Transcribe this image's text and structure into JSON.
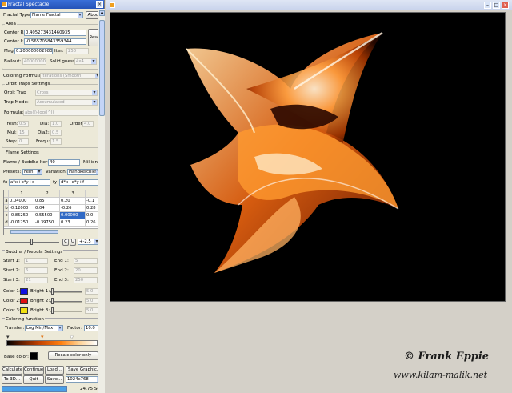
{
  "window": {
    "title": "Fractal Spectacle",
    "close_glyph": "×"
  },
  "top": {
    "fractal_type_label": "Fractal Type:",
    "fractal_type_value": "Flame Fractal",
    "about_label": "About"
  },
  "area": {
    "group_label": "Area",
    "center_r_label": "Center R:",
    "center_r_value": "0.405273431460935",
    "center_i_label": "Center I:",
    "center_i_value": "-0.565705843359344",
    "reset_label": "Reset",
    "mag_label": "Mag",
    "mag_value": "0.2000000029802",
    "iter_label": "Iter:",
    "iter_value": "250",
    "bailout_label": "Bailout:",
    "bailout_value": "400000000",
    "solid_guess_label": "Solid guess:",
    "solid_guess_value": "4x4"
  },
  "coloring_formula": {
    "label": "Coloring Formula:",
    "value": "Iterations (Smooth)"
  },
  "orbit": {
    "group_label": "Orbit Traps Settings",
    "trap_label": "Orbit Trap",
    "trap_value": "Cross",
    "mode_label": "Trap Mode:",
    "mode_value": "Accumulated",
    "formula_label": "Formula:",
    "formula_value": "abs(l)-log(l^l)",
    "thresh_label": "Tresh:",
    "thresh_value": "0.5",
    "dia_label": "Dia:",
    "dia_value": "1.0",
    "order_label": "Order:",
    "order_value": "4.0",
    "mul_label": "Mul:",
    "mul_value": "15",
    "dia2_label": "Dia2:",
    "dia2_value": "0.5",
    "step_label": "Step:",
    "step_value": "0",
    "freq_label": "Frequ:",
    "freq_value": "1.5"
  },
  "flame": {
    "group_label": "Flame Settings",
    "iter_label": "Flame / Buddha Iter:",
    "iter_value": "40",
    "millions_label": "Millions",
    "presets_label": "Presets:",
    "presets_value": "Fern",
    "variation_label": "Variation:",
    "variation_value": "Handkerchief",
    "fx_label": "fx",
    "fx_value": "a*x+b*y+c",
    "fy_label": "fy",
    "fy_value": "d*x+e*y+f",
    "columns": [
      "",
      "1",
      "2",
      "3",
      ""
    ],
    "rows": [
      {
        "name": "a",
        "cells": [
          "0.04000",
          "0.85",
          "0.20",
          "-0.1"
        ]
      },
      {
        "name": "b",
        "cells": [
          "-0.12000",
          "0.04",
          "-0.26",
          "0.28"
        ]
      },
      {
        "name": "c",
        "cells": [
          "-0.85250",
          "0.55500",
          "0.00000",
          "0.0"
        ]
      },
      {
        "name": "d",
        "cells": [
          "-0.01250",
          "-0.39750",
          "0.23",
          "0.26"
        ]
      }
    ],
    "c_label": "C",
    "u_label": "U",
    "range_value": "+-2.5"
  },
  "buddha": {
    "group_label": "Buddha / Nebula Settings",
    "start1_label": "Start 1:",
    "start1_value": "1",
    "end1_label": "End 1:",
    "end1_value": "5",
    "start2_label": "Start 2:",
    "start2_value": "6",
    "end2_label": "End 2:",
    "end2_value": "20",
    "start3_label": "Start 3:",
    "start3_value": "21",
    "end3_label": "End 3:",
    "end3_value": "250",
    "color1_label": "Color 1:",
    "bright1_label": "Bright 1:",
    "bright1_value": "5.0",
    "color2_label": "Color 2:",
    "bright2_label": "Bright 2:",
    "bright2_value": "5.0",
    "color3_label": "Color 3:",
    "bright3_label": "Bright 3:",
    "bright3_value": "5.0",
    "color1": "#1010e0",
    "color2": "#e01010",
    "color3": "#f0e010"
  },
  "coloring_function": {
    "group_label": "Coloring function",
    "transfer_label": "Transfer:",
    "transfer_value": "Log Min/Max",
    "factor_label": "Factor:",
    "factor_value": "10.0",
    "base_color_label": "Base color:",
    "recalc_label": "Recalc color only"
  },
  "bottom_buttons": {
    "calculate": "Calculate",
    "continue": "Continue",
    "load": "Load...",
    "save_graphic": "Save Graphic...",
    "to3d": "To 3D...",
    "quit": "Quit",
    "save": "Save...",
    "size_value": "1024x768"
  },
  "status": {
    "time": "24.75 Sec"
  },
  "watermark": {
    "line1": "© Frank Eppie",
    "line2": "www.kilam-malik.net"
  }
}
